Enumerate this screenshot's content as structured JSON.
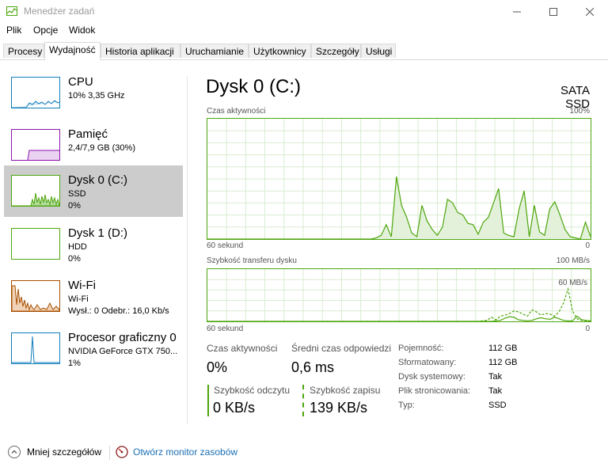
{
  "window": {
    "title": "Menedżer zadań"
  },
  "menu": {
    "items": [
      "Plik",
      "Opcje",
      "Widok"
    ]
  },
  "tabs": [
    "Procesy",
    "Wydajność",
    "Historia aplikacji",
    "Uruchamianie",
    "Użytkownicy",
    "Szczegóły",
    "Usługi"
  ],
  "active_tab": "Wydajność",
  "sidebar": {
    "items": [
      {
        "title": "CPU",
        "lines": [
          "10% 3,35 GHz"
        ],
        "color": "#117dbb"
      },
      {
        "title": "Pamięć",
        "lines": [
          "2,4/7,9 GB (30%)"
        ],
        "color": "#8b12ae"
      },
      {
        "title": "Dysk 0 (C:)",
        "lines": [
          "SSD",
          "0%"
        ],
        "color": "#4da60c"
      },
      {
        "title": "Dysk 1 (D:)",
        "lines": [
          "HDD",
          "0%"
        ],
        "color": "#4da60c"
      },
      {
        "title": "Wi-Fi",
        "lines": [
          "Wi-Fi",
          "Wysł.: 0 Odebr.: 16,0 Kb/s"
        ],
        "color": "#a74f01"
      },
      {
        "title": "Procesor graficzny 0",
        "lines": [
          "NVIDIA GeForce GTX 750...",
          "1%"
        ],
        "color": "#117dbb"
      }
    ]
  },
  "main": {
    "title": "Dysk 0 (C:)",
    "type": "SATA SSD",
    "chart1": {
      "label": "Czas aktywności",
      "max": "100%",
      "xleft": "60 sekund",
      "xright": "0"
    },
    "chart2": {
      "label": "Szybkość transferu dysku",
      "max": "100 MB/s",
      "ref": "60 MB/s",
      "xleft": "60 sekund",
      "xright": "0"
    },
    "stats": {
      "active_label": "Czas aktywności",
      "active_value": "0%",
      "response_label": "Średni czas odpowiedzi",
      "response_value": "0,6 ms",
      "read_label": "Szybkość odczytu",
      "read_value": "0 KB/s",
      "write_label": "Szybkość zapisu",
      "write_value": "139 KB/s"
    },
    "properties": [
      {
        "label": "Pojemność:",
        "value": "112 GB"
      },
      {
        "label": "Sformatowany:",
        "value": "112 GB"
      },
      {
        "label": "Dysk systemowy:",
        "value": "Tak"
      },
      {
        "label": "Plik stronicowania:",
        "value": "Tak"
      },
      {
        "label": "Typ:",
        "value": "SSD"
      }
    ]
  },
  "footer": {
    "less": "Mniej szczegółów",
    "monitor": "Otwórz monitor zasobów"
  },
  "colors": {
    "disk": "#4da60c",
    "cpu": "#117dbb",
    "memory": "#8b12ae",
    "wifi": "#a74f01",
    "link": "#1a6fb5"
  },
  "chart_data": [
    {
      "type": "area",
      "title": "Czas aktywności",
      "ylim": [
        0,
        100
      ],
      "x_range_label": [
        "60 sekund",
        "0"
      ],
      "values": [
        0,
        0,
        0,
        0,
        0,
        0,
        0,
        0,
        0,
        0,
        0,
        0,
        0,
        0,
        0,
        0,
        0,
        0,
        0,
        0,
        0,
        0,
        0,
        0,
        0,
        0,
        0,
        0,
        0,
        0,
        0,
        0,
        0,
        1,
        3,
        12,
        2,
        52,
        28,
        18,
        5,
        2,
        28,
        15,
        8,
        3,
        10,
        33,
        30,
        22,
        20,
        13,
        12,
        4,
        14,
        18,
        30,
        42,
        5,
        3,
        2,
        25,
        40,
        2,
        28,
        6,
        3,
        25,
        31,
        20,
        8,
        2,
        1,
        0,
        14,
        2
      ]
    },
    {
      "type": "line",
      "title": "Szybkość transferu dysku",
      "ylim": [
        0,
        100
      ],
      "series": [
        {
          "name": "",
          "style": "solid",
          "values": [
            0,
            0,
            0,
            0,
            0,
            0,
            0,
            0,
            0,
            0,
            0,
            0,
            0,
            0,
            0,
            0,
            0,
            0,
            0,
            0,
            0,
            0,
            0,
            0,
            0,
            0,
            0,
            0,
            0,
            0,
            0,
            0,
            0,
            0,
            0,
            0,
            0,
            0,
            0,
            0,
            0,
            0,
            0,
            0,
            0,
            0,
            0,
            0,
            0,
            0,
            0,
            0,
            0,
            0,
            0,
            0,
            0,
            0,
            0,
            0,
            0,
            0,
            0,
            0,
            1,
            2,
            6,
            9,
            8,
            3,
            2,
            1,
            2,
            5,
            7,
            5,
            4,
            8,
            5,
            2,
            1,
            1,
            10,
            3,
            2,
            1
          ]
        },
        {
          "name": "",
          "style": "dashed",
          "values": [
            0,
            0,
            0,
            0,
            0,
            0,
            0,
            0,
            0,
            0,
            0,
            0,
            0,
            0,
            0,
            0,
            0,
            0,
            0,
            0,
            0,
            0,
            0,
            0,
            0,
            0,
            0,
            0,
            0,
            0,
            0,
            0,
            0,
            0,
            0,
            0,
            0,
            0,
            0,
            0,
            0,
            0,
            0,
            0,
            0,
            0,
            0,
            0,
            0,
            0,
            0,
            0,
            0,
            0,
            0,
            0,
            0,
            0,
            0,
            0,
            0,
            1,
            2,
            8,
            3,
            10,
            12,
            15,
            20,
            18,
            14,
            10,
            22,
            18,
            12,
            15,
            14,
            10,
            18,
            35,
            62,
            20,
            5,
            2,
            1,
            0
          ]
        }
      ]
    }
  ]
}
